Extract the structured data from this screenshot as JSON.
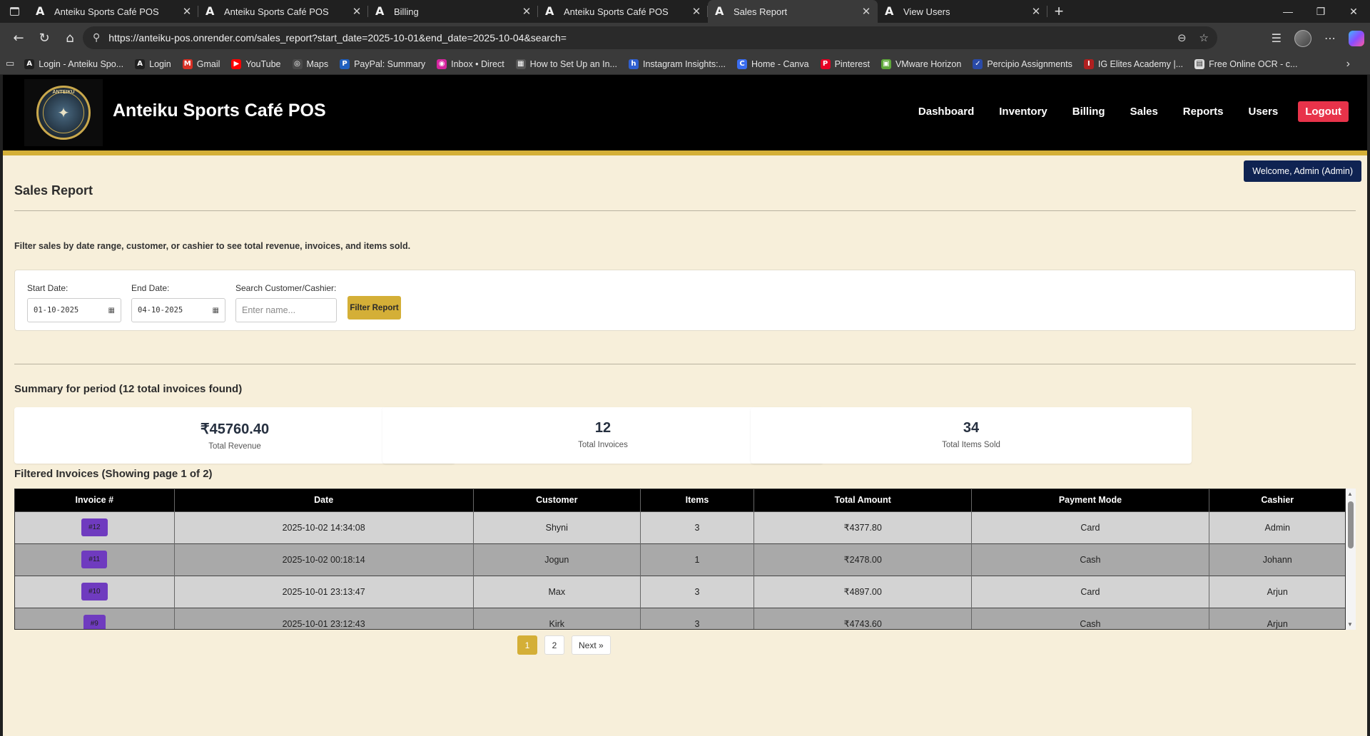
{
  "browser": {
    "tabs": [
      {
        "title": "Anteiku Sports Café POS",
        "active": false
      },
      {
        "title": "Anteiku Sports Café POS",
        "active": false
      },
      {
        "title": "Billing",
        "active": false
      },
      {
        "title": "Anteiku Sports Café POS",
        "active": false
      },
      {
        "title": "Sales Report",
        "active": true
      },
      {
        "title": "View Users",
        "active": false
      }
    ],
    "url": "https://anteiku-pos.onrender.com/sales_report?start_date=2025-10-01&end_date=2025-10-04&search=",
    "bookmarks": [
      {
        "label": "Login - Anteiku Spo...",
        "icon": "A",
        "color": "#202020"
      },
      {
        "label": "Login",
        "icon": "A",
        "color": "#202020"
      },
      {
        "label": "Gmail",
        "icon": "M",
        "color": "#d93025"
      },
      {
        "label": "YouTube",
        "icon": "▶",
        "color": "#ff0000"
      },
      {
        "label": "Maps",
        "icon": "◎",
        "color": "#4a4a4a"
      },
      {
        "label": "PayPal: Summary",
        "icon": "P",
        "color": "#1f5fbf"
      },
      {
        "label": "Inbox • Direct",
        "icon": "◉",
        "color": "#d6249f"
      },
      {
        "label": "How to Set Up an In...",
        "icon": "▦",
        "color": "#555555"
      },
      {
        "label": "Instagram Insights:...",
        "icon": "h",
        "color": "#2f5fd0"
      },
      {
        "label": "Home - Canva",
        "icon": "C",
        "color": "#3a6df0"
      },
      {
        "label": "Pinterest",
        "icon": "P",
        "color": "#e60023"
      },
      {
        "label": "VMware Horizon",
        "icon": "▣",
        "color": "#5fa83b"
      },
      {
        "label": "Percipio Assignments",
        "icon": "✓",
        "color": "#2a4aa8"
      },
      {
        "label": "IG Elites Academy |...",
        "icon": "I",
        "color": "#b02020"
      },
      {
        "label": "Free Online OCR - c...",
        "icon": "▤",
        "color": "#dddddd"
      }
    ]
  },
  "header": {
    "brand": "Anteiku Sports Café POS",
    "logo_text": "ANTEIKU",
    "nav": [
      "Dashboard",
      "Inventory",
      "Billing",
      "Sales",
      "Reports",
      "Users"
    ],
    "logout": "Logout"
  },
  "welcome": "Welcome, Admin (Admin)",
  "page_title": "Sales Report",
  "intro": "Filter sales by date range, customer, or cashier to see total revenue, invoices, and items sold.",
  "filter": {
    "start_label": "Start Date:",
    "start_value": "01-10-2025",
    "end_label": "End Date:",
    "end_value": "04-10-2025",
    "search_label": "Search Customer/Cashier:",
    "search_placeholder": "Enter name...",
    "button": "Filter Report"
  },
  "summary": {
    "title": "Summary for period (12 total invoices found)",
    "revenue_value": "₹45760.40",
    "revenue_label": "Total Revenue",
    "invoices_value": "12",
    "invoices_label": "Total Invoices",
    "items_value": "34",
    "items_label": "Total Items Sold"
  },
  "invoices": {
    "title": "Filtered Invoices (Showing page 1 of 2)",
    "columns": [
      "Invoice #",
      "Date",
      "Customer",
      "Items",
      "Total Amount",
      "Payment Mode",
      "Cashier"
    ],
    "rows": [
      [
        "#12",
        "2025-10-02 14:34:08",
        "Shyni",
        "3",
        "₹4377.80",
        "Card",
        "Admin"
      ],
      [
        "#11",
        "2025-10-02 00:18:14",
        "Jogun",
        "1",
        "₹2478.00",
        "Cash",
        "Johann"
      ],
      [
        "#10",
        "2025-10-01 23:13:47",
        "Max",
        "3",
        "₹4897.00",
        "Card",
        "Arjun"
      ],
      [
        "#9",
        "2025-10-01 23:12:43",
        "Kirk",
        "3",
        "₹4743.60",
        "Cash",
        "Arjun"
      ]
    ]
  },
  "pagination": {
    "pages": [
      "1",
      "2"
    ],
    "current": "1",
    "next": "Next »"
  }
}
